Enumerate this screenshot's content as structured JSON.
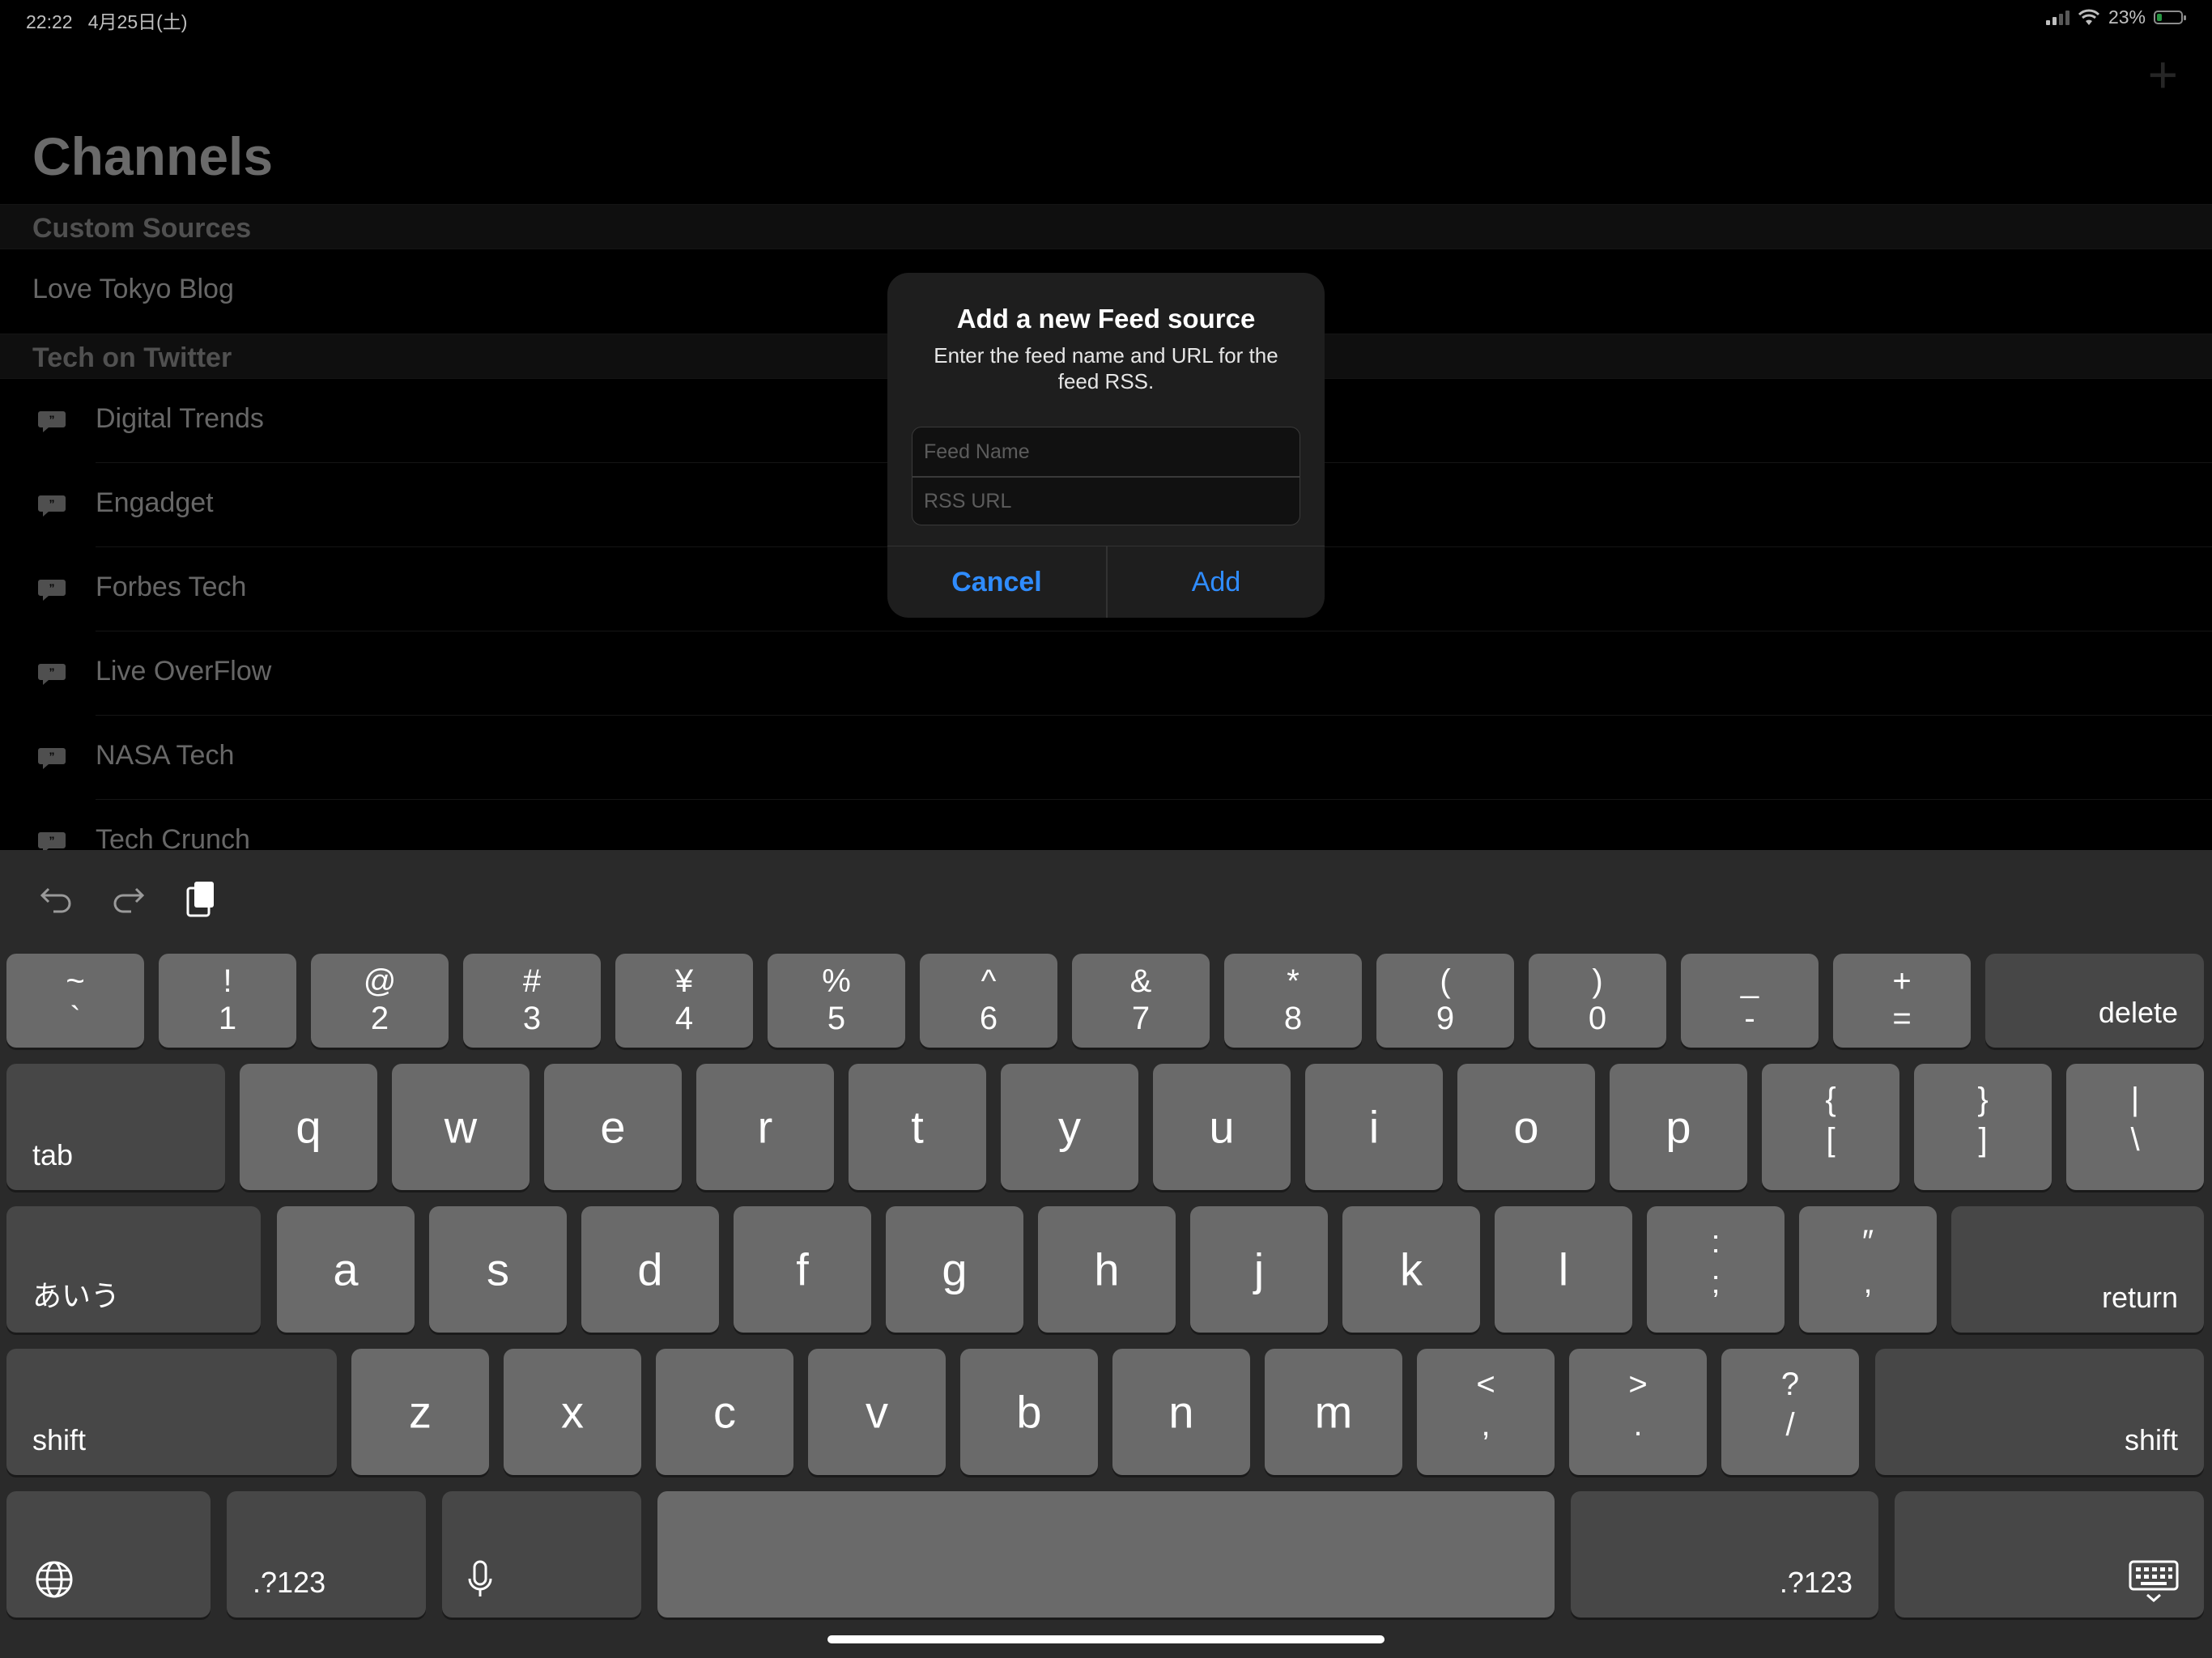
{
  "status_bar": {
    "time": "22:22",
    "date": "4月25日(土)",
    "battery": "23%",
    "battery_level": 0.23
  },
  "app": {
    "title": "Channels",
    "add_icon": "plus-icon",
    "sections": [
      {
        "header": "Custom Sources",
        "items": [
          "Love Tokyo Blog"
        ]
      },
      {
        "header": "Tech on Twitter",
        "items": [
          "Digital Trends",
          "Engadget",
          "Forbes Tech",
          "Live OverFlow",
          "NASA Tech",
          "Tech Crunch"
        ]
      }
    ],
    "item_icon": "chat-bubble-icon"
  },
  "alert": {
    "title": "Add a new Feed source",
    "message": "Enter the feed name and URL for the feed RSS.",
    "feed_name_placeholder": "Feed Name",
    "rss_url_placeholder": "RSS URL",
    "feed_name_value": "",
    "rss_url_value": "",
    "cancel": "Cancel",
    "add": "Add",
    "accent": "#2f8cff"
  },
  "keyboard": {
    "toolbar": [
      "undo-icon",
      "redo-icon",
      "clipboard-icon"
    ],
    "row1": [
      {
        "top": "~",
        "bot": "`"
      },
      {
        "top": "!",
        "bot": "1"
      },
      {
        "top": "@",
        "bot": "2"
      },
      {
        "top": "#",
        "bot": "3"
      },
      {
        "top": "¥",
        "bot": "4"
      },
      {
        "top": "%",
        "bot": "5"
      },
      {
        "top": "^",
        "bot": "6"
      },
      {
        "top": "&",
        "bot": "7"
      },
      {
        "top": "*",
        "bot": "8"
      },
      {
        "top": "(",
        "bot": "9"
      },
      {
        "top": ")",
        "bot": "0"
      },
      {
        "top": "_",
        "bot": "-"
      },
      {
        "top": "+",
        "bot": "="
      }
    ],
    "delete": "delete",
    "tab": "tab",
    "row2": [
      "q",
      "w",
      "e",
      "r",
      "t",
      "y",
      "u",
      "i",
      "o",
      "p"
    ],
    "row2_sym": [
      {
        "top": "{",
        "bot": "["
      },
      {
        "top": "}",
        "bot": "]"
      },
      {
        "top": "|",
        "bot": "\\"
      }
    ],
    "kana": "あいう",
    "row3": [
      "a",
      "s",
      "d",
      "f",
      "g",
      "h",
      "j",
      "k",
      "l"
    ],
    "row3_sym": [
      {
        "top": ":",
        "bot": ";"
      },
      {
        "top": "″",
        "bot": ","
      }
    ],
    "return": "return",
    "shift": "shift",
    "row4": [
      "z",
      "x",
      "c",
      "v",
      "b",
      "n",
      "m"
    ],
    "row4_sym": [
      {
        "top": "<",
        "bot": ","
      },
      {
        "top": ">",
        "bot": "."
      },
      {
        "top": "?",
        "bot": "/"
      }
    ],
    "numbers": ".?123"
  }
}
